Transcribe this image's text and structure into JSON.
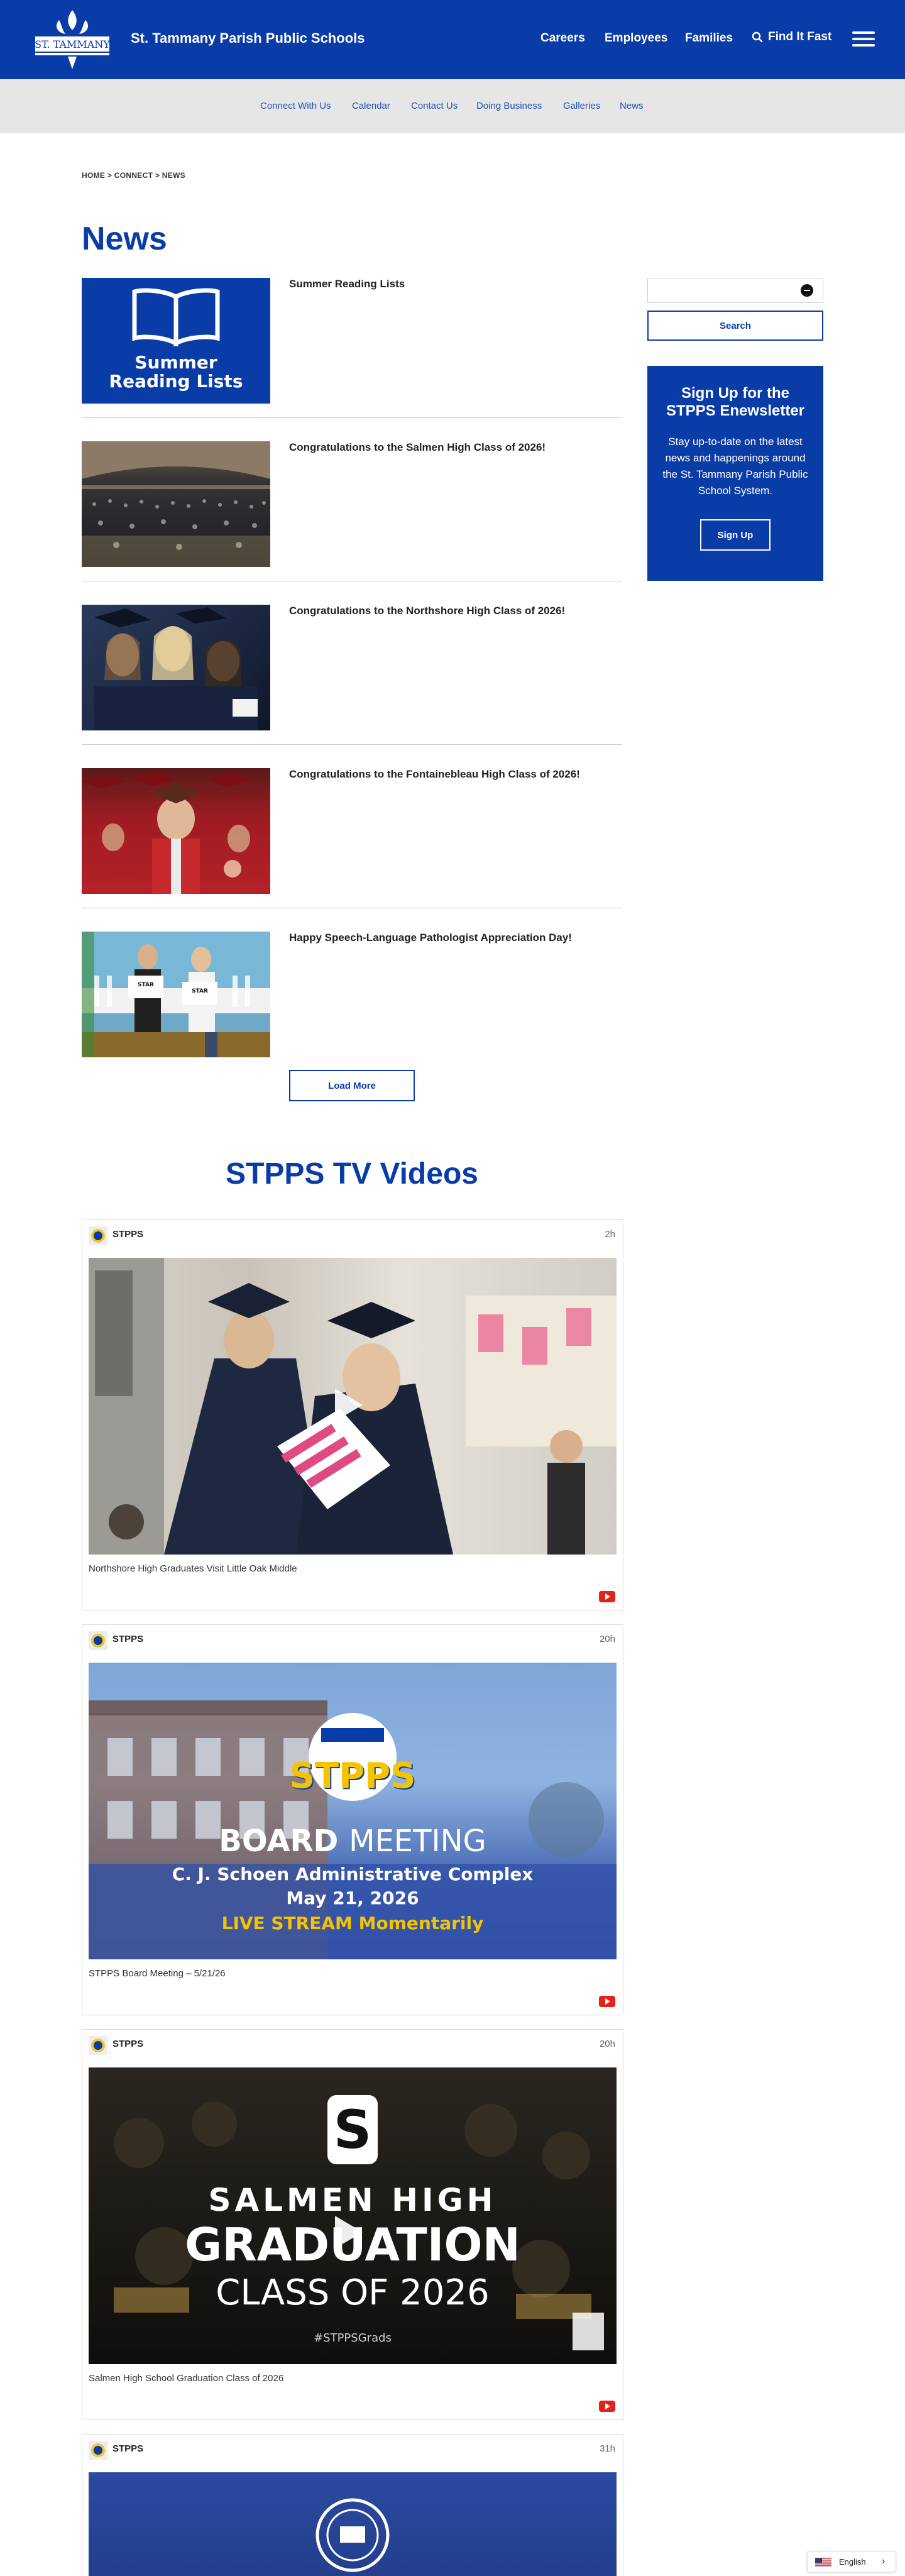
{
  "header": {
    "site_title": "St. Tammany Parish Public Schools",
    "logo_text": "ST. TAMMANY",
    "nav": [
      "Careers",
      "Employees",
      "Families"
    ],
    "find_fast": "Find It Fast"
  },
  "subnav": [
    "Connect With Us",
    "Calendar",
    "Contact Us",
    "Doing Business",
    "Galleries",
    "News"
  ],
  "breadcrumb": "HOME > CONNECT > NEWS",
  "page_title": "News",
  "news": [
    {
      "headline": "Summer Reading Lists",
      "thumb_text": [
        "Summer",
        "Reading Lists"
      ]
    },
    {
      "headline": "Congratulations to the Salmen High Class of 2026!"
    },
    {
      "headline": "Congratulations to the Northshore High Class of 2026!"
    },
    {
      "headline": "Congratulations to the Fontainebleau High Class of 2026!"
    },
    {
      "headline": "Happy Speech-Language Pathologist Appreciation Day!",
      "sign_text": "STAR"
    }
  ],
  "load_more": "Load More",
  "sidebar": {
    "search_placeholder": "",
    "search_button": "Search",
    "enews_title": "Sign Up for the STPPS Enewsletter",
    "enews_text": "Stay up-to-date on the latest news and happenings around the St. Tammany Parish Public School System.",
    "enews_button": "Sign Up"
  },
  "tv_heading": "STPPS TV Videos",
  "videos": [
    {
      "channel": "STPPS",
      "time": "2h",
      "caption": "Northshore High Graduates Visit Little Oak Middle"
    },
    {
      "channel": "STPPS",
      "time": "20h",
      "caption": "STPPS Board Meeting – 5/21/26",
      "thumb": {
        "brand": "STPPS",
        "title_bold": "BOARD",
        "title_light": "MEETING",
        "line2": "C. J. Schoen Administrative Complex",
        "line3": "May 21, 2026",
        "line4": "LIVE STREAM Momentarily"
      }
    },
    {
      "channel": "STPPS",
      "time": "20h",
      "caption": "Salmen High School Graduation Class of 2026",
      "thumb": {
        "letter": "S",
        "line1": "SALMEN HIGH",
        "line2": "GRADUATION",
        "line3": "CLASS OF 2026",
        "tag": "#STPPSGrads"
      }
    },
    {
      "channel": "STPPS",
      "time": "31h"
    }
  ],
  "language": "English",
  "colors": {
    "brand_blue": "#0a3ca8",
    "link_blue": "#1f4fb5",
    "subnav_bg": "#e6e6e6"
  }
}
